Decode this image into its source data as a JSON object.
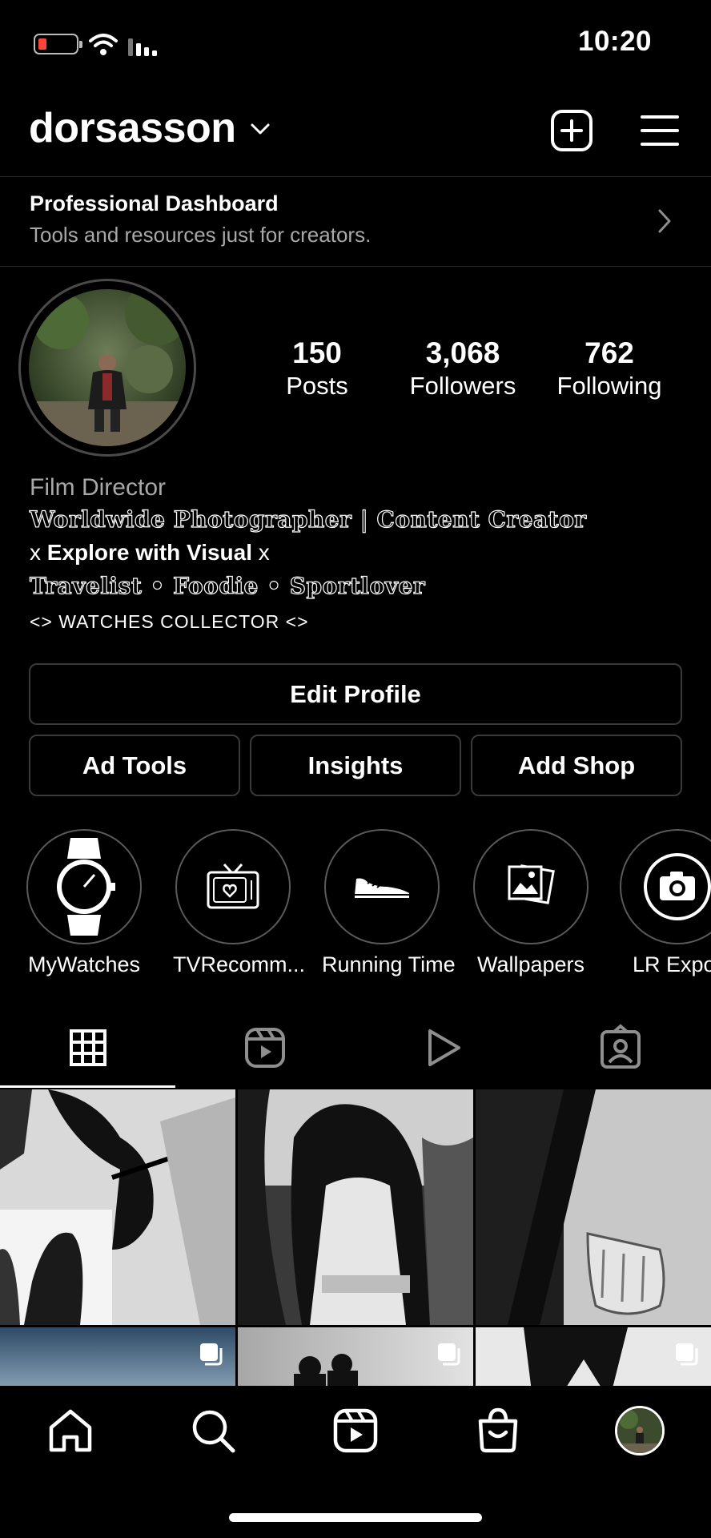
{
  "status_bar": {
    "time": "10:20",
    "icons": [
      "battery-icon",
      "wifi-icon",
      "cellular-icon"
    ]
  },
  "header": {
    "username": "dorsasson",
    "icons": [
      "chevron-down-icon",
      "new-post-icon",
      "menu-icon"
    ]
  },
  "dashboard": {
    "title": "Professional Dashboard",
    "subtitle": "Tools and resources just for creators."
  },
  "stats": [
    {
      "value": "150",
      "label": "Posts"
    },
    {
      "value": "3,068",
      "label": "Followers"
    },
    {
      "value": "762",
      "label": "Following"
    }
  ],
  "bio": {
    "category": "Film Director",
    "line1": "Worldwide Photographer | Content Creator",
    "line2_prefix": "x ",
    "line2_bold": "Explore with Visual",
    "line2_suffix": " x",
    "line3": "Travelist • Foodie • Sportlover",
    "line4": "<> WATCHES COLLECTOR <>"
  },
  "buttons": {
    "edit_profile": "Edit Profile",
    "ad_tools": "Ad Tools",
    "insights": "Insights",
    "add_shop": "Add Shop"
  },
  "highlights": [
    {
      "label": "MyWatches",
      "icon": "watch-icon"
    },
    {
      "label": "TVRecomm...",
      "icon": "tv-heart-icon"
    },
    {
      "label": "Running Time",
      "icon": "sneaker-icon"
    },
    {
      "label": "Wallpapers",
      "icon": "photos-icon"
    },
    {
      "label": "LR Expo",
      "icon": "camera-icon"
    }
  ],
  "tabs": [
    {
      "icon": "grid-icon",
      "active": true
    },
    {
      "icon": "reels-icon",
      "active": false
    },
    {
      "icon": "play-icon",
      "active": false
    },
    {
      "icon": "tagged-icon",
      "active": false
    }
  ],
  "bottom_nav": [
    "home-icon",
    "search-icon",
    "reels-icon",
    "shop-icon",
    "profile-avatar"
  ],
  "colors": {
    "background": "#000000",
    "text": "#ffffff",
    "muted": "#a8a8a8",
    "border": "#3a3a3a"
  }
}
